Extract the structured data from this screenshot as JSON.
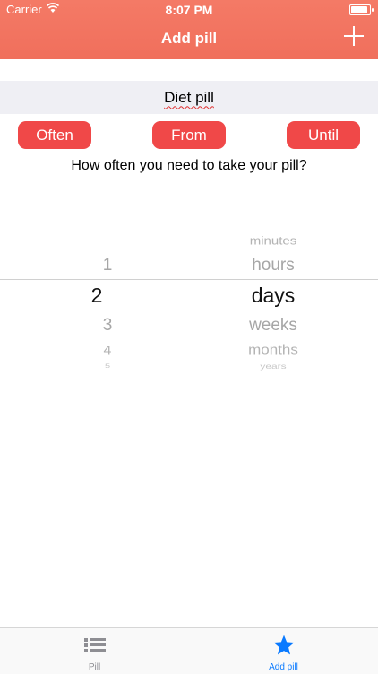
{
  "status_bar": {
    "carrier": "Carrier",
    "time": "8:07 PM"
  },
  "nav": {
    "title": "Add pill",
    "add_icon": "plus-icon"
  },
  "pill_name": "Diet pill",
  "buttons": {
    "often": "Often",
    "from": "From",
    "until": "Until"
  },
  "question": "How often you need to take your pill?",
  "picker": {
    "numbers": [
      "1",
      "2",
      "3",
      "4",
      "5"
    ],
    "units": [
      "minutes",
      "hours",
      "days",
      "weeks",
      "months",
      "years"
    ],
    "selected_number": "2",
    "selected_unit": "days"
  },
  "tabbar": {
    "tabs": [
      {
        "label": "Pill",
        "icon": "list-icon"
      },
      {
        "label": "Add pill",
        "icon": "star-icon"
      }
    ],
    "active_color": "#0a7aff",
    "inactive_color": "#8e8e93"
  },
  "colors": {
    "header": "#f47a66",
    "button": "#f04848"
  }
}
